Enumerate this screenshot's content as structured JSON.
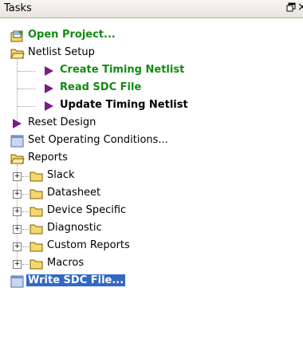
{
  "panel": {
    "title": "Tasks",
    "float_icon": "float-window-icon",
    "close_glyph": "×"
  },
  "tree": {
    "open_project": "Open Project...",
    "netlist_setup": "Netlist Setup",
    "create_timing_netlist": "Create Timing Netlist",
    "read_sdc_file": "Read SDC File",
    "update_timing_netlist": "Update Timing Netlist",
    "reset_design": "Reset Design",
    "set_operating_conditions": "Set Operating Conditions...",
    "reports": "Reports",
    "report_items": [
      "Slack",
      "Datasheet",
      "Device Specific",
      "Diagnostic",
      "Custom Reports",
      "Macros"
    ],
    "write_sdc_file": "Write SDC File..."
  },
  "colors": {
    "green_text": "#138a13",
    "selection": "#3169c6",
    "arrow": "#7a1b86",
    "folder": "#f5d86b"
  }
}
